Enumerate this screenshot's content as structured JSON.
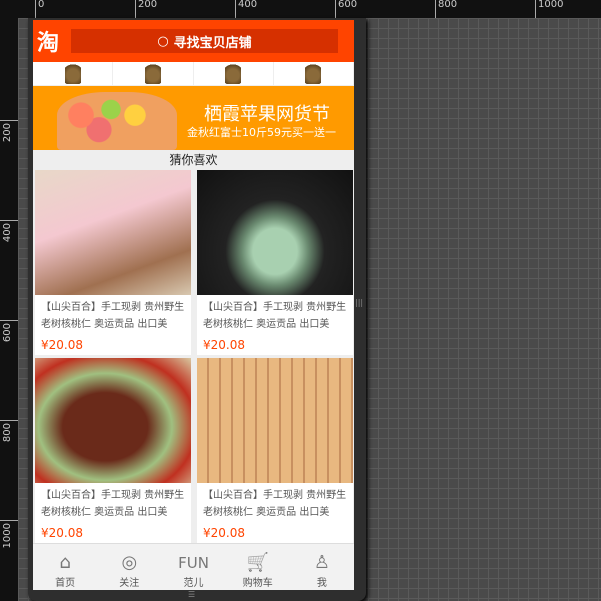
{
  "ruler": {
    "top": [
      "0",
      "200",
      "400",
      "600",
      "800",
      "1000"
    ],
    "left": [
      "200",
      "400",
      "600",
      "800",
      "1000"
    ]
  },
  "header": {
    "logo": "淘",
    "search_placeholder": "寻找宝贝店铺"
  },
  "banner": {
    "title": "栖霞苹果网货节",
    "subtitle": "金秋红富士10斤59元买一送一"
  },
  "section_title": "猜你喜欢",
  "products": [
    {
      "title": "【山尖百合】手工现剥 贵州野生老树核桃仁 奥运贡品 出口美",
      "price": "¥20.08"
    },
    {
      "title": "【山尖百合】手工现剥 贵州野生老树核桃仁 奥运贡品 出口美",
      "price": "¥20.08"
    },
    {
      "title": "【山尖百合】手工现剥 贵州野生老树核桃仁 奥运贡品 出口美",
      "price": "¥20.08"
    },
    {
      "title": "【山尖百合】手工现剥 贵州野生老树核桃仁 奥运贡品 出口美",
      "price": "¥20.08"
    }
  ],
  "tabs": [
    {
      "label": "首页",
      "icon": "⌂"
    },
    {
      "label": "关注",
      "icon": "◎"
    },
    {
      "label": "范儿",
      "icon": "FUN"
    },
    {
      "label": "购物车",
      "icon": "🛒"
    },
    {
      "label": "我",
      "icon": "♙"
    }
  ],
  "colors": {
    "brand": "#ff4400",
    "banner": "#ff9a00"
  }
}
